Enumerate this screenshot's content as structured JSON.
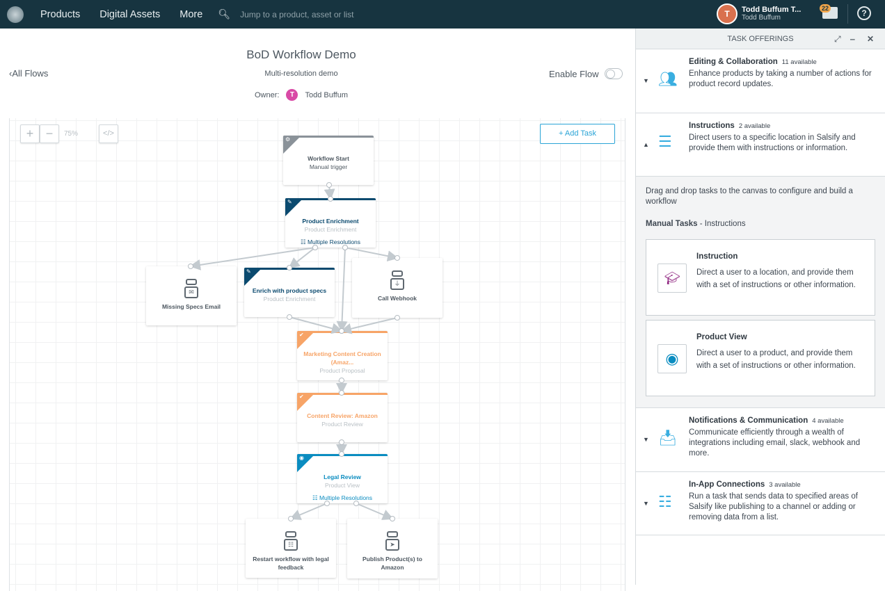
{
  "nav": {
    "items": [
      "Products",
      "Digital Assets",
      "More"
    ],
    "search_placeholder": "Jump to a product, asset or list",
    "user_initial": "T",
    "user_name": "Todd Buffum T...",
    "user_sub": "Todd Buffum",
    "notifications": "22",
    "help": "?"
  },
  "flow": {
    "back": "All Flows",
    "title": "BoD Workflow Demo",
    "description": "Multi-resolution demo",
    "owner_label": "Owner:",
    "owner_initial": "T",
    "owner_name": "Todd Buffum",
    "enable_label": "Enable Flow",
    "enabled": false
  },
  "canvas": {
    "zoom_in": "+",
    "zoom_out": "−",
    "zoom_level": "75%",
    "code_toggle": "</>",
    "add_task": "+ Add Task"
  },
  "colors": {
    "start": "#8a9299",
    "enrichment": "#0b4a6f",
    "proposal": "#f7a467",
    "view": "#0a8cc0",
    "accent": "#2aa4d6"
  },
  "nodes": [
    {
      "title": "Workflow Start",
      "subtitle": "Manual trigger",
      "footer": "",
      "kind": "start",
      "icon": "gear-icon"
    },
    {
      "title": "Product Enrichment",
      "subtitle": "Product Enrichment",
      "footer": "Multiple Resolutions",
      "kind": "enrichment",
      "icon": "pencil-icon"
    },
    {
      "title": "Missing Specs Email",
      "subtitle": "",
      "footer": "",
      "kind": "robot",
      "icon": "email-icon"
    },
    {
      "title": "Enrich with product specs",
      "subtitle": "Product Enrichment",
      "footer": "",
      "kind": "enrichment",
      "icon": "pencil-icon"
    },
    {
      "title": "Call Webhook",
      "subtitle": "",
      "footer": "",
      "kind": "robot",
      "icon": "plug-icon"
    },
    {
      "title": "Marketing Content Creation (Amaz...",
      "subtitle": "Product Proposal",
      "footer": "",
      "kind": "proposal",
      "icon": "check-icon"
    },
    {
      "title": "Content Review: Amazon",
      "subtitle": "Product Review",
      "footer": "",
      "kind": "proposal",
      "icon": "check-icon"
    },
    {
      "title": "Legal Review",
      "subtitle": "Product View",
      "footer": "Multiple Resolutions",
      "kind": "view",
      "icon": "eye-icon"
    },
    {
      "title": "Restart workflow with legal feedback",
      "subtitle": "",
      "footer": "",
      "kind": "robot",
      "icon": "hierarchy-icon"
    },
    {
      "title": "Publish Product(s) to Amazon",
      "subtitle": "",
      "footer": "",
      "kind": "robot",
      "icon": "rocket-icon"
    }
  ],
  "panel": {
    "title": "TASK OFFERINGS",
    "categories": [
      {
        "title": "Editing & Collaboration",
        "count": "11 available",
        "description": "Enhance products by taking a number of actions for product record updates.",
        "expanded": false,
        "icon": "users-icon"
      },
      {
        "title": "Instructions",
        "count": "2 available",
        "description": "Direct users to a specific location in Salsify and provide them with instructions or information.",
        "expanded": true,
        "icon": "list-icon"
      },
      {
        "title": "Notifications & Communication",
        "count": "4 available",
        "description": "Communicate efficiently through a wealth of integrations including email, slack, webhook and more.",
        "expanded": false,
        "icon": "inbox-icon"
      },
      {
        "title": "In-App Connections",
        "count": "3 available",
        "description": "Run a task that sends data to specified areas of Salsify like publishing to a channel or adding or removing data from a list.",
        "expanded": false,
        "icon": "hierarchy-icon"
      }
    ],
    "intro": "Drag and drop tasks to the canvas to configure and build a workflow",
    "manual_label": "Manual Tasks",
    "manual_suffix": " - Instructions",
    "tasks": [
      {
        "title": "Instruction",
        "description": "Direct a user to a location, and provide them with a set of instructions or other information.",
        "icon": "graduation-cap-icon",
        "color": "#8a1a7a"
      },
      {
        "title": "Product View",
        "description": "Direct a user to a product, and provide them with a set of instructions or other information.",
        "icon": "eye-icon",
        "color": "#0a8cc0"
      }
    ]
  }
}
